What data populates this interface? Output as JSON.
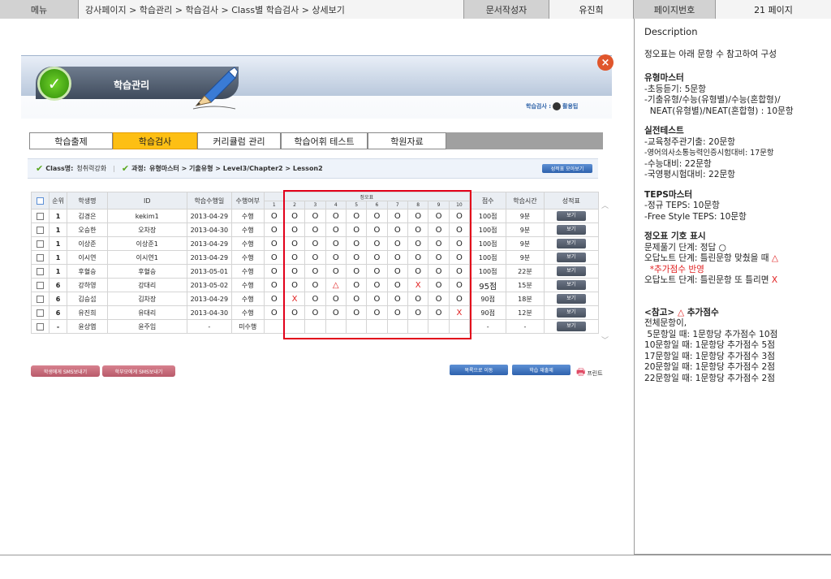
{
  "header": {
    "menu_label": "메뉴",
    "breadcrumb": "강사페이지 > 학습관리 > 학습검사 > Class별 학습검사 > 상세보기",
    "author_label": "문서작성자",
    "author": "유진희",
    "page_no_label": "페이지번호",
    "page_no": "21 페이지"
  },
  "app": {
    "banner_title": "학습관리",
    "helper_text": "학습검사 : ",
    "helper_link": "활용팁",
    "close_icon": "close-icon",
    "tabs": [
      "학습출제",
      "학습검사",
      "커리큘럼 관리",
      "학습어휘 테스트",
      "학원자료"
    ],
    "active_tab": "학습검사",
    "class_label": "Class명:",
    "class_value": "청취력강화",
    "course_label": "과정:",
    "course_value": "유형마스터 > 기출유형 > Level3/Chapter2 > Lesson2",
    "report_button": "성적표 모아보기",
    "table": {
      "headers": [
        "순위",
        "학생명",
        "ID",
        "학습수행일",
        "수행여부",
        "정오표",
        "점수",
        "학습시간",
        "성적표"
      ],
      "answer_numbers": [
        "1",
        "2",
        "3",
        "4",
        "5",
        "6",
        "7",
        "8",
        "9",
        "10"
      ],
      "rows": [
        {
          "rank": "1",
          "name": "김경은",
          "id": "kekim1",
          "date": "2013-04-29",
          "status": "수행",
          "marks": [
            "O",
            "O",
            "O",
            "O",
            "O",
            "O",
            "O",
            "O",
            "O",
            "O"
          ],
          "score": "100점",
          "time": "9분",
          "btn": "보기"
        },
        {
          "rank": "1",
          "name": "오승한",
          "id": "오차장",
          "date": "2013-04-30",
          "status": "수행",
          "marks": [
            "O",
            "O",
            "O",
            "O",
            "O",
            "O",
            "O",
            "O",
            "O",
            "O"
          ],
          "score": "100점",
          "time": "9분",
          "btn": "보기"
        },
        {
          "rank": "1",
          "name": "이상준",
          "id": "이상준1",
          "date": "2013-04-29",
          "status": "수행",
          "marks": [
            "O",
            "O",
            "O",
            "O",
            "O",
            "O",
            "O",
            "O",
            "O",
            "O"
          ],
          "score": "100점",
          "time": "9분",
          "btn": "보기"
        },
        {
          "rank": "1",
          "name": "이시연",
          "id": "이시연1",
          "date": "2013-04-29",
          "status": "수행",
          "marks": [
            "O",
            "O",
            "O",
            "O",
            "O",
            "O",
            "O",
            "O",
            "O",
            "O"
          ],
          "score": "100점",
          "time": "9분",
          "btn": "보기"
        },
        {
          "rank": "1",
          "name": "후혈승",
          "id": "후혈승",
          "date": "2013-05-01",
          "status": "수행",
          "marks": [
            "O",
            "O",
            "O",
            "O",
            "O",
            "O",
            "O",
            "O",
            "O",
            "O"
          ],
          "score": "100점",
          "time": "22분",
          "btn": "보기"
        },
        {
          "rank": "6",
          "name": "강하영",
          "id": "강대리",
          "date": "2013-05-02",
          "status": "수행",
          "marks": [
            "O",
            "O",
            "O",
            "△",
            "O",
            "O",
            "O",
            "X",
            "O",
            "O"
          ],
          "score": "95점",
          "time": "15분",
          "btn": "보기"
        },
        {
          "rank": "6",
          "name": "김승섭",
          "id": "김차장",
          "date": "2013-04-29",
          "status": "수행",
          "marks": [
            "O",
            "X",
            "O",
            "O",
            "O",
            "O",
            "O",
            "O",
            "O",
            "O"
          ],
          "score": "90점",
          "time": "18분",
          "btn": "보기"
        },
        {
          "rank": "6",
          "name": "유진희",
          "id": "유대리",
          "date": "2013-04-30",
          "status": "수행",
          "marks": [
            "O",
            "O",
            "O",
            "O",
            "O",
            "O",
            "O",
            "O",
            "O",
            "X"
          ],
          "score": "90점",
          "time": "12분",
          "btn": "보기"
        },
        {
          "rank": "-",
          "name": "윤상엽",
          "id": "윤주임",
          "date": "-",
          "status": "미수행",
          "marks": [
            "",
            "",
            "",
            "",
            "",
            "",
            "",
            "",
            "",
            ""
          ],
          "score": "-",
          "time": "-",
          "btn": "보기"
        }
      ]
    },
    "sms_student": "학생에게 SMS보내기",
    "sms_parent": "학부모에게 SMS보내기",
    "go_list": "목록으로 이동",
    "submit": "학습 재출제",
    "print": "프린트"
  },
  "description": {
    "heading": "Description",
    "intro": "정오표는 아래 문항 수 참고하여 구성",
    "sections": [
      {
        "title": "유형마스터",
        "lines": [
          "-초등듣기: 5문항",
          "-기출유형/수능(유형별)/수능(혼합형)/",
          "  NEAT(유형별)/NEAT(혼합형) : 10문항"
        ]
      },
      {
        "title": "실전테스트",
        "lines": [
          "-교육청주관기출: 20문항",
          "-영어의사소통능력인증시험대비: 17문항",
          "-수능대비: 22문항",
          "-국영평시험대비: 22문항"
        ]
      },
      {
        "title": "TEPS마스터",
        "lines": [
          "-정규 TEPS: 10문항",
          "-Free Style TEPS: 10문항"
        ]
      }
    ],
    "symbols": {
      "title": "정오표 기호 표시",
      "line1": "문제풀기 단계: 정답 ○",
      "line2_a": "오답노트 단계: 틀린문항 맞췄을 때 ",
      "line2_b": "△",
      "line3": "  *추가점수 반영",
      "line4_a": "오답노트 단계: 틀린문항 또 틀리면 ",
      "line4_b": "X"
    },
    "note": {
      "title_a": "<참고> ",
      "title_b": "△",
      "title_c": " 추가점수",
      "lines": [
        "전체문항이,",
        " 5문항일 때: 1문항당 추가점수 10점",
        "10문항일 때: 1문항당 추가점수 5점",
        "17문항일 때: 1문항당 추가점수 3점",
        "20문항일 때: 1문항당 추가점수 2점",
        "22문항일 때: 1문항당 추가점수 2점"
      ]
    }
  },
  "colors": {
    "accent_tab": "#fdbf14",
    "error_mark": "#e02020",
    "highlight_box": "#e2001a"
  }
}
